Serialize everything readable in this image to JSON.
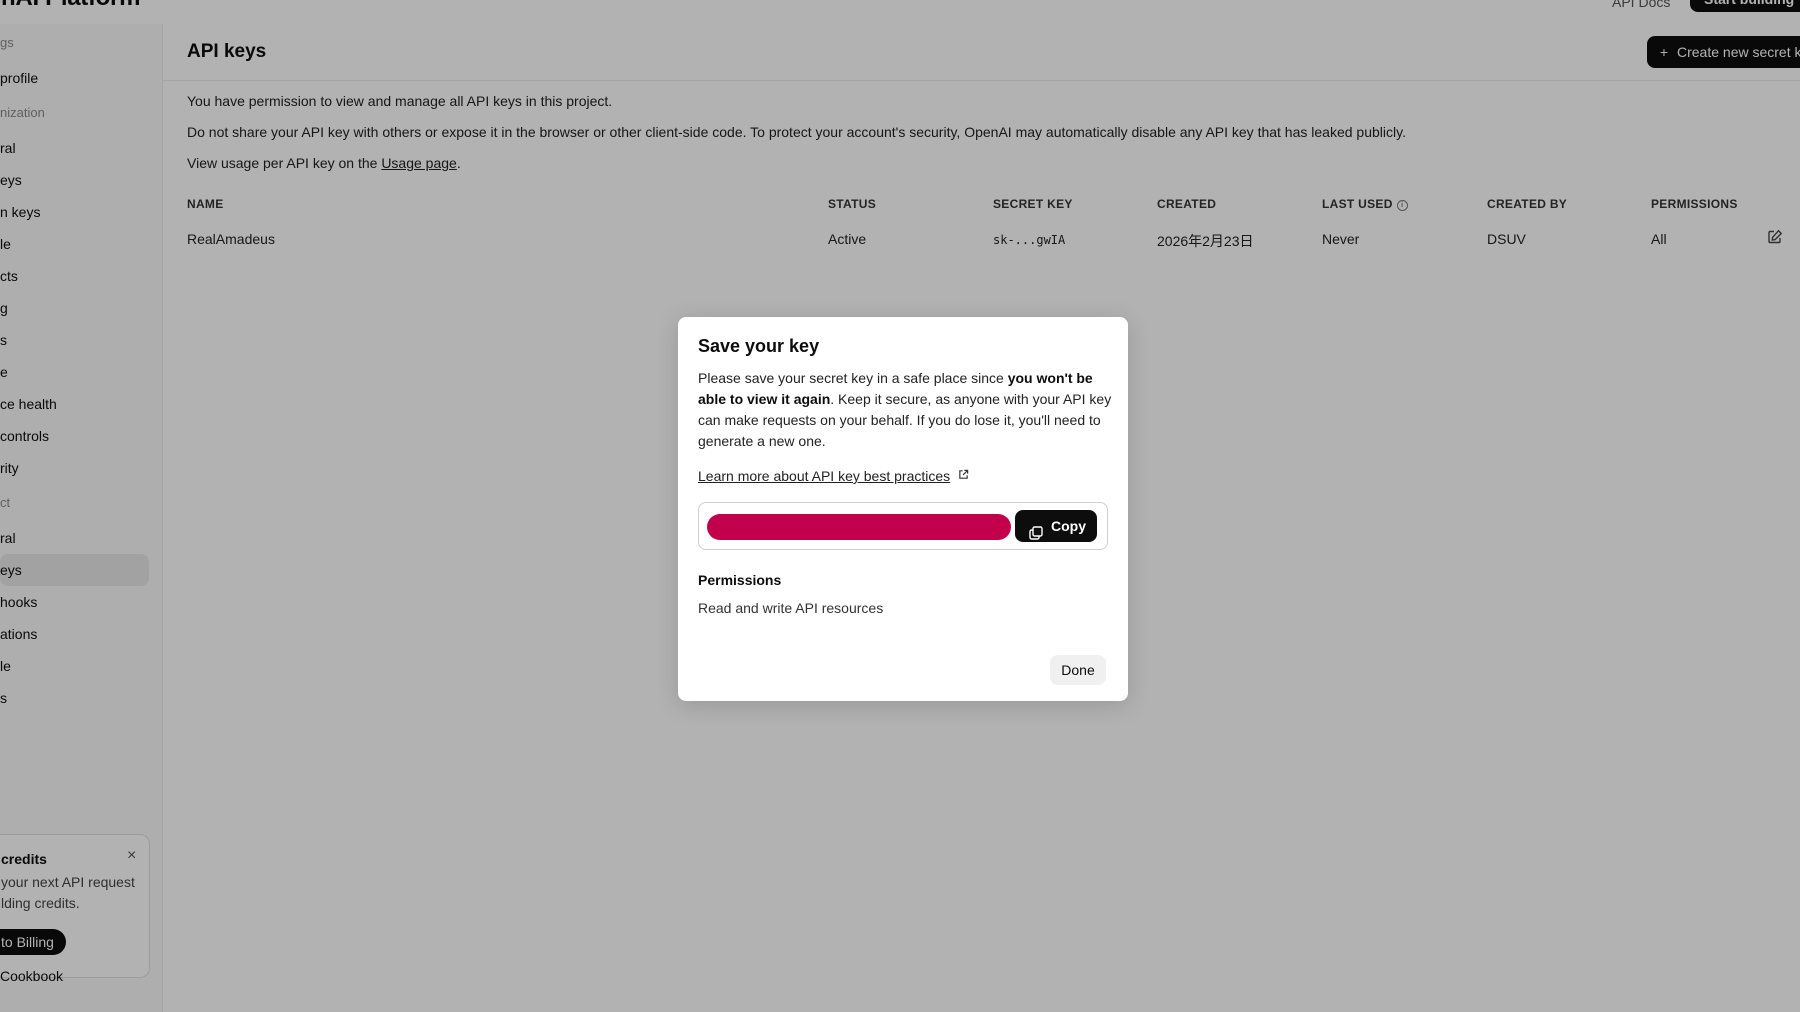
{
  "topbar": {
    "brand": "enAI Platform",
    "api_docs": "API Docs",
    "start_building": "Start building"
  },
  "sidebar": {
    "sections": [
      {
        "label": "gs"
      },
      {
        "label": "nization"
      },
      {
        "label": "ct"
      }
    ],
    "items": [
      {
        "label": "profile"
      },
      {
        "label": "ral"
      },
      {
        "label": "eys"
      },
      {
        "label": "n keys"
      },
      {
        "label": "le"
      },
      {
        "label": "cts"
      },
      {
        "label": "g"
      },
      {
        "label": "s"
      },
      {
        "label": "e"
      },
      {
        "label": "ce health"
      },
      {
        "label": "controls"
      },
      {
        "label": "rity"
      },
      {
        "label": "ral"
      },
      {
        "label": "eys"
      },
      {
        "label": "hooks"
      },
      {
        "label": "ations"
      },
      {
        "label": "le"
      },
      {
        "label": "s"
      }
    ],
    "credits": {
      "title": "credits",
      "text": "your next API request lding credits.",
      "button": "to Billing",
      "close": "×"
    },
    "cookbook": "Cookbook"
  },
  "main": {
    "title": "API keys",
    "create_button": "Create new secret key",
    "create_icon": "plus-icon",
    "para1": "You have permission to view and manage all API keys in this project.",
    "para2": "Do not share your API key with others or expose it in the browser or other client-side code. To protect your account's security, OpenAI may automatically disable any API key that has leaked publicly.",
    "para3_prefix": "View usage per API key on the ",
    "para3_link": "Usage page",
    "para3_suffix": "."
  },
  "table": {
    "headers": [
      "NAME",
      "STATUS",
      "SECRET KEY",
      "CREATED",
      "LAST USED",
      "CREATED BY",
      "PERMISSIONS"
    ],
    "rows": [
      {
        "name": "RealAmadeus",
        "status": "Active",
        "secret": "sk-...gwIA",
        "created": "2026年2月23日",
        "last_used": "Never",
        "created_by": "DSUV",
        "permissions": "All"
      }
    ]
  },
  "modal": {
    "title": "Save your key",
    "desc_prefix": "Please save your secret key in a safe place since ",
    "desc_bold": "you won't be able to view it again",
    "desc_suffix": ". Keep it secure, as anyone with your API key can make requests on your behalf. If you do lose it, you'll need to generate a new one.",
    "learn_link": "Learn more about API key best practices",
    "copy_label": "Copy",
    "permissions_title": "Permissions",
    "permissions_text": "Read and write API resources",
    "done_label": "Done"
  },
  "colors": {
    "accent": "#0d0d0d",
    "redaction": "#c2004c",
    "overlay": "rgba(0,0,0,0.30)"
  }
}
